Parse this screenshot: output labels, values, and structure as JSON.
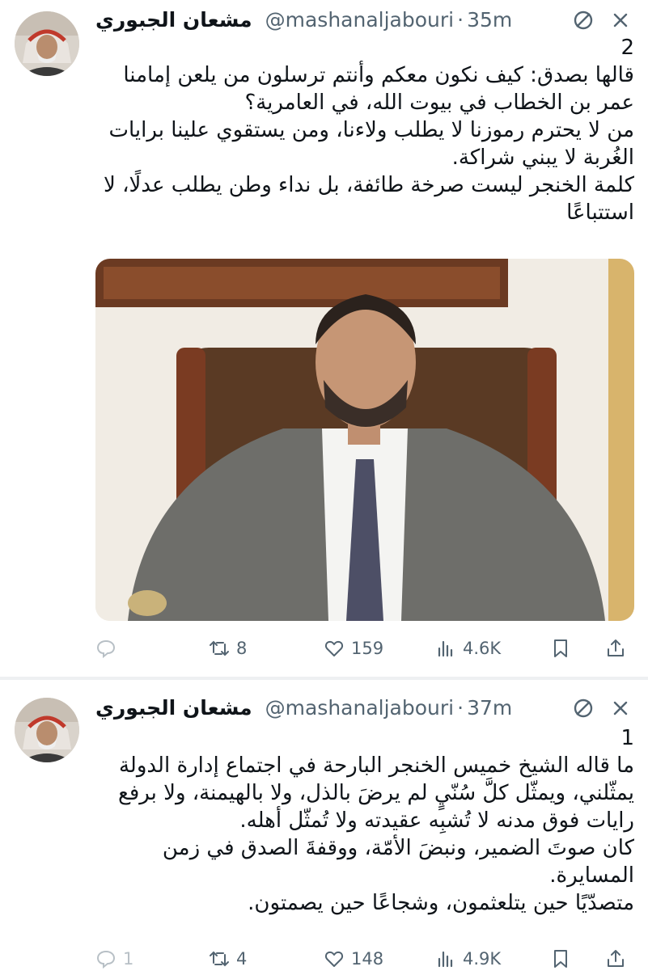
{
  "colors": {
    "text": "#0f1419",
    "secondary": "#536471",
    "divider": "#eef0f2",
    "background": "#ffffff"
  },
  "tweets": [
    {
      "author_name": "مشعان الجبوري",
      "handle": "@mashanaljabouri",
      "separator": "·",
      "time": "35m",
      "number_line": "2",
      "paragraphs": [
        "قالها بصدق: كيف نكون معكم وأنتم ترسلون من يلعن إمامنا عمر بن الخطاب في بيوت الله، في العامرية؟",
        "من لا يحترم رموزنا لا يطلب ولاءنا، ومن يستقوي علينا برايات الغُربة لا يبني شراكة.",
        "كلمة الخنجر ليست صرخة طائفة، بل نداء وطن يطلب عدلًا، لا استتباعًا"
      ],
      "has_photo": true,
      "icons": {
        "top_right": [
          "no-sign-icon",
          "more-icon"
        ]
      },
      "stats": {
        "replies": "",
        "retweets": "8",
        "likes": "159",
        "views": "4.6K"
      }
    },
    {
      "author_name": "مشعان الجبوري",
      "handle": "@mashanaljabouri",
      "separator": "·",
      "time": "37m",
      "number_line": "1",
      "paragraphs": [
        "ما قاله الشيخ خميس الخنجر البارحة في اجتماع إدارة الدولة يمثّلني، ويمثّل كلَّ سُنّيٍ لم يرضَ بالذل، ولا بالهيمنة، ولا برفع رايات فوق مدنه لا تُشبِه عقيدته ولا تُمثّل أهله.",
        "كان صوتَ الضمير، ونبضَ الأمّة، ووقفةَ الصدق في زمن المسايرة.",
        "متصدّيًا حين يتلعثمون، وشجاعًا حين يصمتون."
      ],
      "has_photo": false,
      "icons": {
        "top_right": [
          "no-sign-icon",
          "more-icon"
        ]
      },
      "stats": {
        "replies": "1",
        "retweets": "4",
        "likes": "148",
        "views": "4.9K"
      }
    }
  ]
}
